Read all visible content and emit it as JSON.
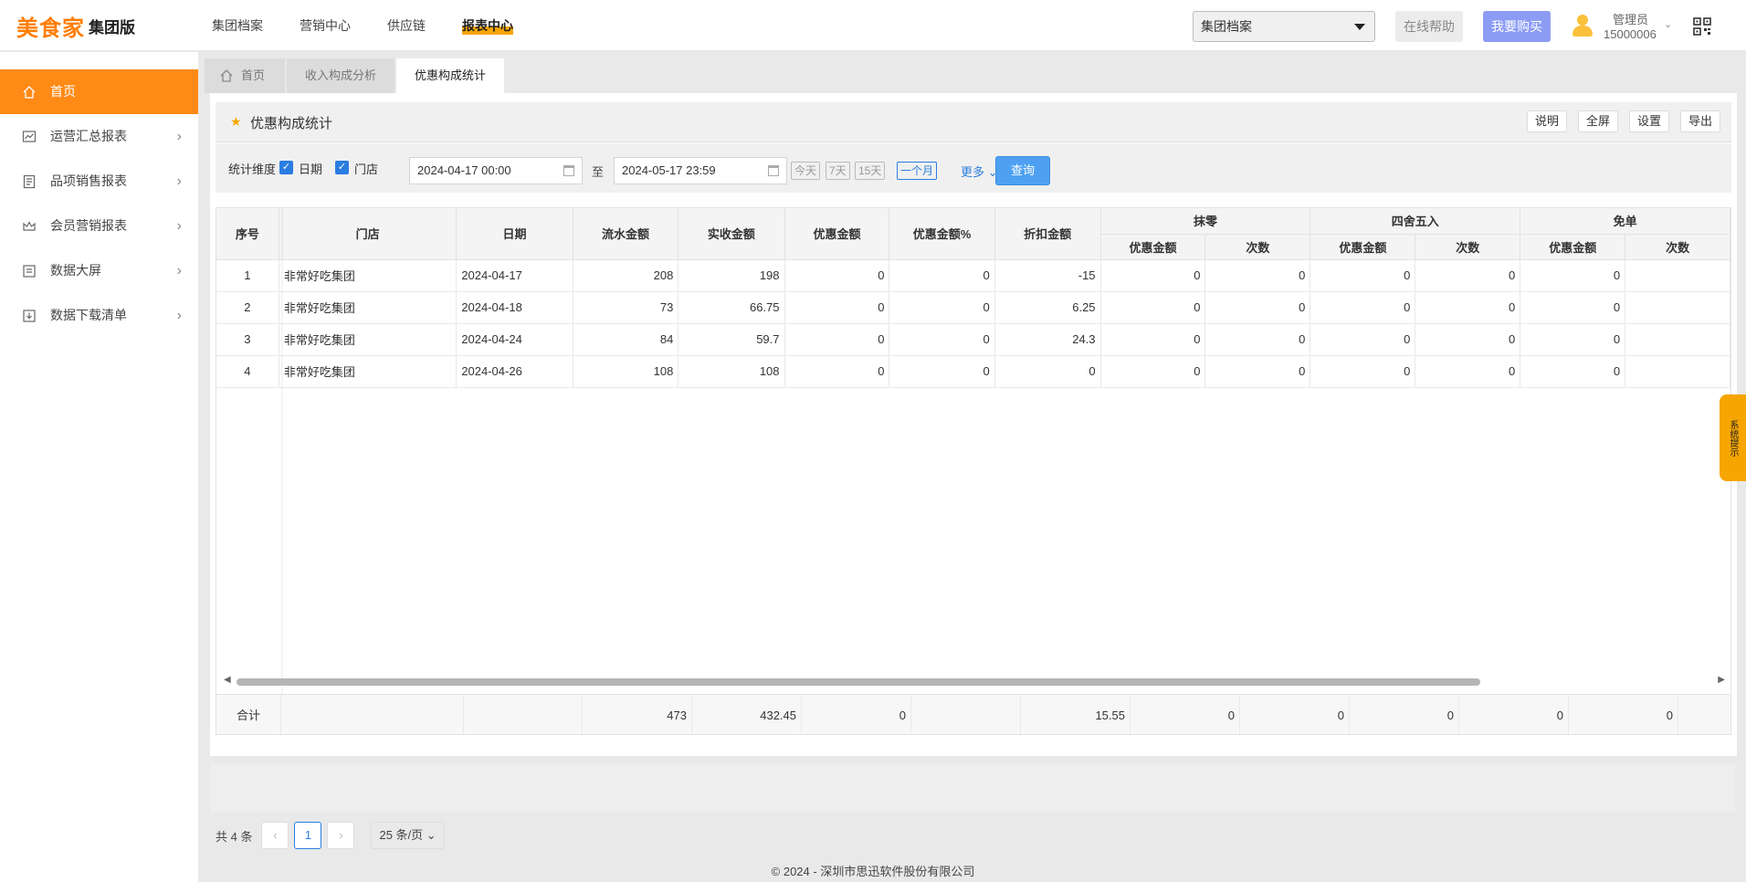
{
  "header": {
    "logo_main": "美食家",
    "logo_sub": "集团版",
    "nav": [
      "集团档案",
      "营销中心",
      "供应链",
      "报表中心"
    ],
    "active_nav": "报表中心",
    "group_select": "集团档案",
    "help_label": "在线帮助",
    "buy_label": "我要购买",
    "user_name": "管理员",
    "user_id": "15000006"
  },
  "sidebar": {
    "items": [
      {
        "label": "首页",
        "icon": "home-icon"
      },
      {
        "label": "运营汇总报表",
        "icon": "chart-icon"
      },
      {
        "label": "品项销售报表",
        "icon": "list-icon"
      },
      {
        "label": "会员营销报表",
        "icon": "crown-icon"
      },
      {
        "label": "数据大屏",
        "icon": "screen-icon"
      },
      {
        "label": "数据下载清单",
        "icon": "download-icon"
      }
    ]
  },
  "tabs": [
    "首页",
    "收入构成分析",
    "优惠构成统计"
  ],
  "page": {
    "title": "优惠构成统计",
    "actions": [
      "说明",
      "全屏",
      "设置",
      "导出"
    ]
  },
  "filters": {
    "dimension_label": "统计维度",
    "dim_date": "日期",
    "dim_store": "门店",
    "start": "2024-04-17 00:00",
    "to": "至",
    "end": "2024-05-17 23:59",
    "quick": [
      "今天",
      "7天",
      "15天",
      "一个月"
    ],
    "more": "更多",
    "query": "查询"
  },
  "table": {
    "headers": {
      "seq": "序号",
      "store": "门店",
      "date": "日期",
      "flow": "流水金额",
      "received": "实收金额",
      "discount": "优惠金额",
      "discount_pct": "优惠金额%",
      "rebate": "折扣金额",
      "group1": "抹零",
      "group2": "四舍五入",
      "group3": "免单",
      "sub_amount": "优惠金额",
      "sub_count": "次数"
    },
    "rows": [
      {
        "seq": "1",
        "store": "非常好吃集团",
        "date": "2024-04-17",
        "flow": "208",
        "received": "198",
        "discount": "0",
        "pct": "0",
        "rebate": "-15",
        "a1": "0",
        "c1": "0",
        "a2": "0",
        "c2": "0",
        "a3": "0"
      },
      {
        "seq": "2",
        "store": "非常好吃集团",
        "date": "2024-04-18",
        "flow": "73",
        "received": "66.75",
        "discount": "0",
        "pct": "0",
        "rebate": "6.25",
        "a1": "0",
        "c1": "0",
        "a2": "0",
        "c2": "0",
        "a3": "0"
      },
      {
        "seq": "3",
        "store": "非常好吃集团",
        "date": "2024-04-24",
        "flow": "84",
        "received": "59.7",
        "discount": "0",
        "pct": "0",
        "rebate": "24.3",
        "a1": "0",
        "c1": "0",
        "a2": "0",
        "c2": "0",
        "a3": "0"
      },
      {
        "seq": "4",
        "store": "非常好吃集团",
        "date": "2024-04-26",
        "flow": "108",
        "received": "108",
        "discount": "0",
        "pct": "0",
        "rebate": "0",
        "a1": "0",
        "c1": "0",
        "a2": "0",
        "c2": "0",
        "a3": "0"
      }
    ],
    "total": {
      "label": "合计",
      "flow": "473",
      "received": "432.45",
      "discount": "0",
      "rebate": "15.55",
      "a1": "0",
      "c1": "0",
      "a2": "0",
      "c2": "0",
      "a3": "0"
    }
  },
  "pager": {
    "total": "共 4 条",
    "current": "1",
    "size": "25 条/页"
  },
  "footer": "© 2024 - 深圳市思迅软件股份有限公司",
  "system_tip": "系统提示",
  "colors": {
    "accent": "#ff8a16",
    "primary": "#2a7de1",
    "buy": "#8c9cf5"
  }
}
